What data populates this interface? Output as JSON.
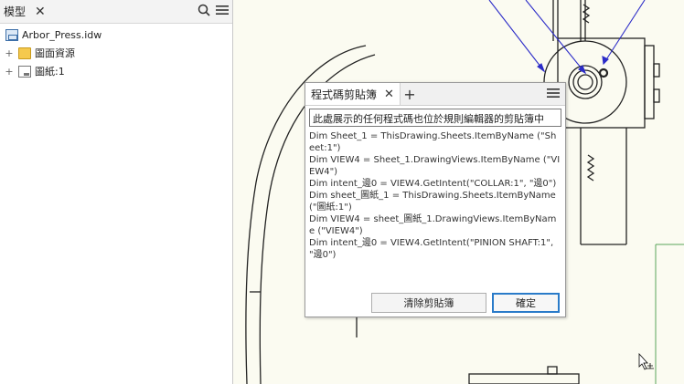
{
  "browser": {
    "title": "模型",
    "tree": {
      "root": "Arbor_Press.idw",
      "items": [
        {
          "label": "圖面資源"
        },
        {
          "label": "圖紙:1"
        }
      ]
    }
  },
  "dialog": {
    "tab_label": "程式碼剪貼簿",
    "description": "此處展示的任何程式碼也位於規則編輯器的剪貼簿中",
    "code_lines": [
      "Dim Sheet_1 = ThisDrawing.Sheets.ItemByName (\"Sheet:1\")",
      "Dim VIEW4 = Sheet_1.DrawingViews.ItemByName (\"VIEW4\")",
      "Dim intent_邊0 = VIEW4.GetIntent(\"COLLAR:1\", \"邊0\")",
      "Dim sheet_圖紙_1 = ThisDrawing.Sheets.ItemByName(\"圖紙:1\")",
      "Dim VIEW4 = sheet_圖紙_1.DrawingViews.ItemByName (\"VIEW4\")",
      "Dim intent_邊0 = VIEW4.GetIntent(\"PINION SHAFT:1\", \"邊0\")"
    ],
    "clear_button": "清除剪貼簿",
    "ok_button": "確定"
  }
}
